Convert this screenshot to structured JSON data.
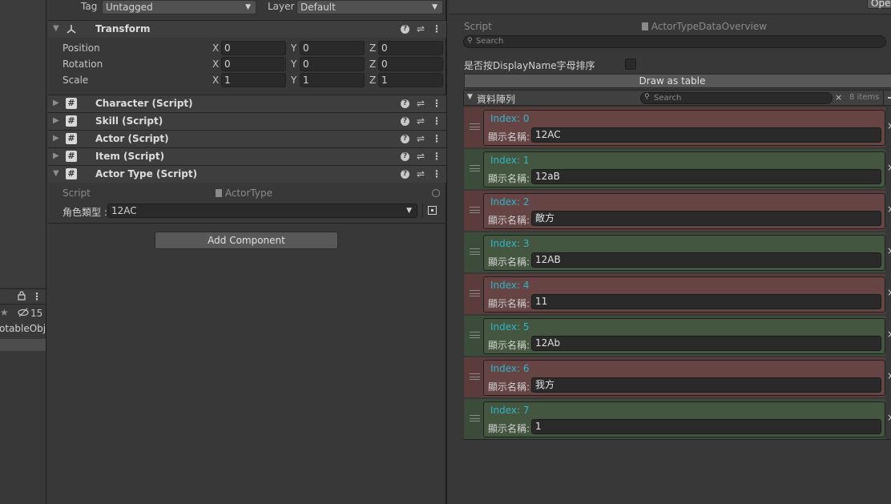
{
  "left_strip": {
    "lock_icon": "lock-icon",
    "kebab": "⋮",
    "star": "★",
    "hidden_count": "15",
    "object_text": "otableObjec"
  },
  "inspector": {
    "tag_label": "Tag",
    "tag_value": "Untagged",
    "layer_label": "Layer",
    "layer_value": "Default",
    "transform": {
      "title": "Transform",
      "rows": [
        {
          "label": "Position",
          "x": "0",
          "y": "0",
          "z": "0"
        },
        {
          "label": "Rotation",
          "x": "0",
          "y": "0",
          "z": "0"
        },
        {
          "label": "Scale",
          "x": "1",
          "y": "1",
          "z": "1"
        }
      ],
      "axis_x": "X",
      "axis_y": "Y",
      "axis_z": "Z"
    },
    "components": [
      {
        "name": "Character (Script)"
      },
      {
        "name": "Skill (Script)"
      },
      {
        "name": "Actor (Script)"
      },
      {
        "name": "Item (Script)"
      },
      {
        "name": "Actor Type (Script)"
      }
    ],
    "actor_type": {
      "script_label": "Script",
      "script_value": "ActorType",
      "field_label": "角色類型 :",
      "field_value": "12AC"
    },
    "add_component": "Add Component"
  },
  "right_panel": {
    "open_btn": "Open",
    "script_label": "Script",
    "script_value": "ActorTypeDataOverview",
    "search_placeholder": "Search",
    "sort_label": "是否按DisplayName字母排序",
    "draw_table": "Draw as table",
    "array_label": "資料陣列",
    "array_search": "Search",
    "items_count": "8 items",
    "name_label": "顯示名稱:",
    "elements": [
      {
        "index": "Index: 0",
        "name": "12AC",
        "tint": "red"
      },
      {
        "index": "Index: 1",
        "name": "12aB",
        "tint": "green"
      },
      {
        "index": "Index: 2",
        "name": "敵方",
        "tint": "red"
      },
      {
        "index": "Index: 3",
        "name": "12AB",
        "tint": "green"
      },
      {
        "index": "Index: 4",
        "name": "11",
        "tint": "red"
      },
      {
        "index": "Index: 5",
        "name": "12Ab",
        "tint": "green"
      },
      {
        "index": "Index: 6",
        "name": "我方",
        "tint": "red"
      },
      {
        "index": "Index: 7",
        "name": "1",
        "tint": "green"
      }
    ]
  },
  "colors": {
    "index_text": "#2fb4c8",
    "red_tint": "#664444",
    "green_tint": "#44563f"
  }
}
